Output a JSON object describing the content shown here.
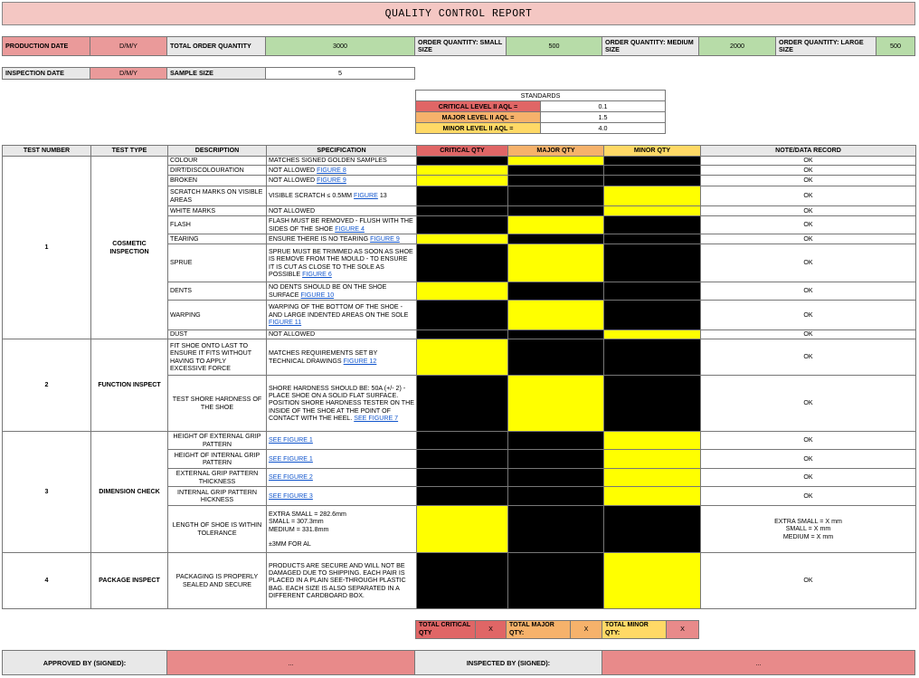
{
  "title": "QUALITY CONTROL REPORT",
  "summary": {
    "production_date_label": "PRODUCTION DATE",
    "production_date_value": "D/M/Y",
    "total_order_qty_label": "TOTAL ORDER QUANTITY",
    "total_order_qty_value": "3000",
    "order_small_label": "ORDER QUANTITY: SMALL SIZE",
    "order_small_value": "500",
    "order_medium_label": "ORDER QUANTITY: MEDIUM SIZE",
    "order_medium_value": "2000",
    "order_large_label": "ORDER QUANTITY: LARGE SIZE",
    "order_large_value": "500",
    "inspection_date_label": "INSPECTION DATE",
    "inspection_date_value": "D/M/Y",
    "sample_size_label": "SAMPLE SIZE",
    "sample_size_value": "5"
  },
  "standards": {
    "header": "STANDARDS",
    "rows": [
      {
        "label": "CRITICAL LEVEL II AQL =",
        "value": "0.1",
        "color": "#e06666"
      },
      {
        "label": "MAJOR LEVEL II AQL =",
        "value": "1.5",
        "color": "#f6b26b"
      },
      {
        "label": "MINOR LEVEL II AQL =",
        "value": "4.0",
        "color": "#ffd966"
      }
    ]
  },
  "columns": {
    "test_number": "TEST NUMBER",
    "test_type": "TEST TYPE",
    "description": "DESCRIPTION",
    "specification": "SPECIFICATION",
    "critical": "CRITICAL QTY",
    "major": "MAJOR QTY",
    "minor": "MINOR QTY",
    "note": "NOTE/DATA RECORD"
  },
  "colors": {
    "critical_header": "#e06666",
    "major_header": "#f6b26b",
    "minor_header": "#ffd966",
    "active_cell": "#ffff00",
    "inactive_cell": "#000000",
    "label_pink": "#ea9a9a",
    "value_green": "#b7dca8"
  },
  "groups": [
    {
      "number": "1",
      "type": "COSMETIC INSPECTION",
      "rows": [
        {
          "desc": "COLOUR",
          "spec": "MATCHES SIGNED GOLDEN SAMPLES",
          "link": "",
          "crit": false,
          "maj": true,
          "min": false,
          "note": "OK"
        },
        {
          "desc": "DIRT/DISCOLOURATION",
          "spec": "NOT ALLOWED",
          "link": "FIGURE 8",
          "crit": true,
          "maj": false,
          "min": false,
          "note": "OK"
        },
        {
          "desc": "BROKEN",
          "spec": "NOT ALLOWED",
          "link": "FIGURE 9",
          "crit": true,
          "maj": false,
          "min": false,
          "note": "OK"
        },
        {
          "desc": "SCRATCH MARKS ON VISIBLE AREAS",
          "spec": "VISIBLE SCRATCH ≤ 0.5MM",
          "link": "FIGURE",
          "suffix": " 13",
          "crit": false,
          "maj": false,
          "min": true,
          "note": "OK"
        },
        {
          "desc": "WHITE MARKS",
          "spec": "NOT ALLOWED",
          "link": "",
          "crit": false,
          "maj": false,
          "min": true,
          "note": "OK"
        },
        {
          "desc": "FLASH",
          "spec": "FLASH MUST BE REMOVED - FLUSH WITH THE SIDES OF THE SHOE",
          "link": "FIGURE 4",
          "crit": false,
          "maj": true,
          "min": false,
          "note": "OK"
        },
        {
          "desc": "TEARING",
          "spec": "ENSURE THERE IS NO TEARING",
          "link": "FIGURE 9",
          "crit": true,
          "maj": false,
          "min": false,
          "note": "OK"
        },
        {
          "desc": "SPRUE",
          "spec": "SPRUE MUST BE TRIMMED AS SOON AS SHOE IS REMOVE FROM THE MOULD - TO ENSURE IT IS CUT AS CLOSE TO THE SOLE AS POSSIBLE",
          "link": "FIGURE 6",
          "crit": false,
          "maj": true,
          "min": false,
          "note": "OK"
        },
        {
          "desc": "DENTS",
          "spec": "NO DENTS SHOULD BE ON THE SHOE SURFACE",
          "link": "FIGURE 10",
          "crit": true,
          "maj": false,
          "min": false,
          "note": "OK"
        },
        {
          "desc": "WARPING",
          "spec": "WARPING OF THE BOTTOM OF THE SHOE - AND LARGE INDENTED AREAS ON THE SOLE",
          "link": "FIGURE 11",
          "crit": false,
          "maj": true,
          "min": false,
          "note": "OK"
        },
        {
          "desc": "DUST",
          "spec": "NOT ALLOWED",
          "link": "",
          "crit": false,
          "maj": false,
          "min": true,
          "note": "OK"
        }
      ]
    },
    {
      "number": "2",
      "type": "FUNCTION INSPECT",
      "rows": [
        {
          "desc": "FIT SHOE ONTO LAST TO ENSURE IT FITS WITHOUT HAVING TO APPLY EXCESSIVE FORCE",
          "spec": "MATCHES REQUIREMENTS SET BY TECHNICAL DRAWINGS",
          "link": "FIGURE 12",
          "crit": true,
          "maj": false,
          "min": false,
          "note": "OK"
        },
        {
          "desc": "TEST SHORE HARDNESS OF THE SHOE",
          "spec": "SHORE HARDNESS SHOULD BE: 50A (+/- 2) - PLACE SHOE ON A SOLID FLAT SURFACE. POSITION SHORE HARDNESS TESTER ON THE INSIDE OF THE SHOE AT THE POINT OF CONTACT WITH THE HEEL.",
          "link": "SEE FIGURE 7",
          "crit": false,
          "maj": true,
          "min": false,
          "note": "OK"
        }
      ]
    },
    {
      "number": "3",
      "type": "DIMENSION CHECK",
      "rows": [
        {
          "desc": "HEIGHT OF EXTERNAL GRIP PATTERN",
          "spec": "",
          "link": "SEE FIGURE 1",
          "crit": false,
          "maj": false,
          "min": true,
          "note": "OK"
        },
        {
          "desc": "HEIGHT OF INTERNAL GRIP PATTERN",
          "spec": "",
          "link": "SEE FIGURE 1",
          "crit": false,
          "maj": false,
          "min": true,
          "note": "OK"
        },
        {
          "desc": "EXTERNAL GRIP PATTERN THICKNESS",
          "spec": "",
          "link": "SEE FIGURE 2",
          "crit": false,
          "maj": false,
          "min": true,
          "note": "OK"
        },
        {
          "desc": "INTERNAL GRIP PATTERN HICKNESS",
          "spec": "",
          "link": "SEE FIGURE 3",
          "crit": false,
          "maj": false,
          "min": true,
          "note": "OK"
        },
        {
          "desc": "LENGTH OF SHOE IS WITHIN TOLERANCE",
          "spec_lines": [
            "EXTRA SMALL = 282.6mm",
            "SMALL = 307.3mm",
            "MEDIUM = 331.8mm",
            "",
            "±3MM FOR AL"
          ],
          "crit": true,
          "maj": false,
          "min": false,
          "note_lines": [
            "EXTRA SMALL = X mm",
            "SMALL = X mm",
            "MEDIUM = X mm"
          ]
        }
      ]
    },
    {
      "number": "4",
      "type": "PACKAGE INSPECT",
      "rows": [
        {
          "desc": "PACKAGING IS PROPERLY SEALED AND SECURE",
          "spec": "PRODUCTS ARE SECURE AND WILL NOT BE DAMAGED DUE TO SHIPPING. EACH PAIR IS PLACED IN A PLAIN SEE-THROUGH PLASTIC BAG. EACH SIZE IS ALSO SEPARATED IN A DIFFERENT CARDBOARD BOX.",
          "link": "",
          "crit": false,
          "maj": false,
          "min": true,
          "note": "OK"
        }
      ]
    }
  ],
  "totals": {
    "critical_label": "TOTAL CRITICAL QTY",
    "critical_value": "X",
    "major_label": "TOTAL MAJOR QTY:",
    "major_value": "X",
    "minor_label": "TOTAL MINOR QTY:",
    "minor_value": "X"
  },
  "footer": {
    "approved_label": "APPROVED BY (SIGNED):",
    "approved_value": "...",
    "inspected_label": "INSPECTED BY (SIGNED):",
    "inspected_value": "..."
  }
}
